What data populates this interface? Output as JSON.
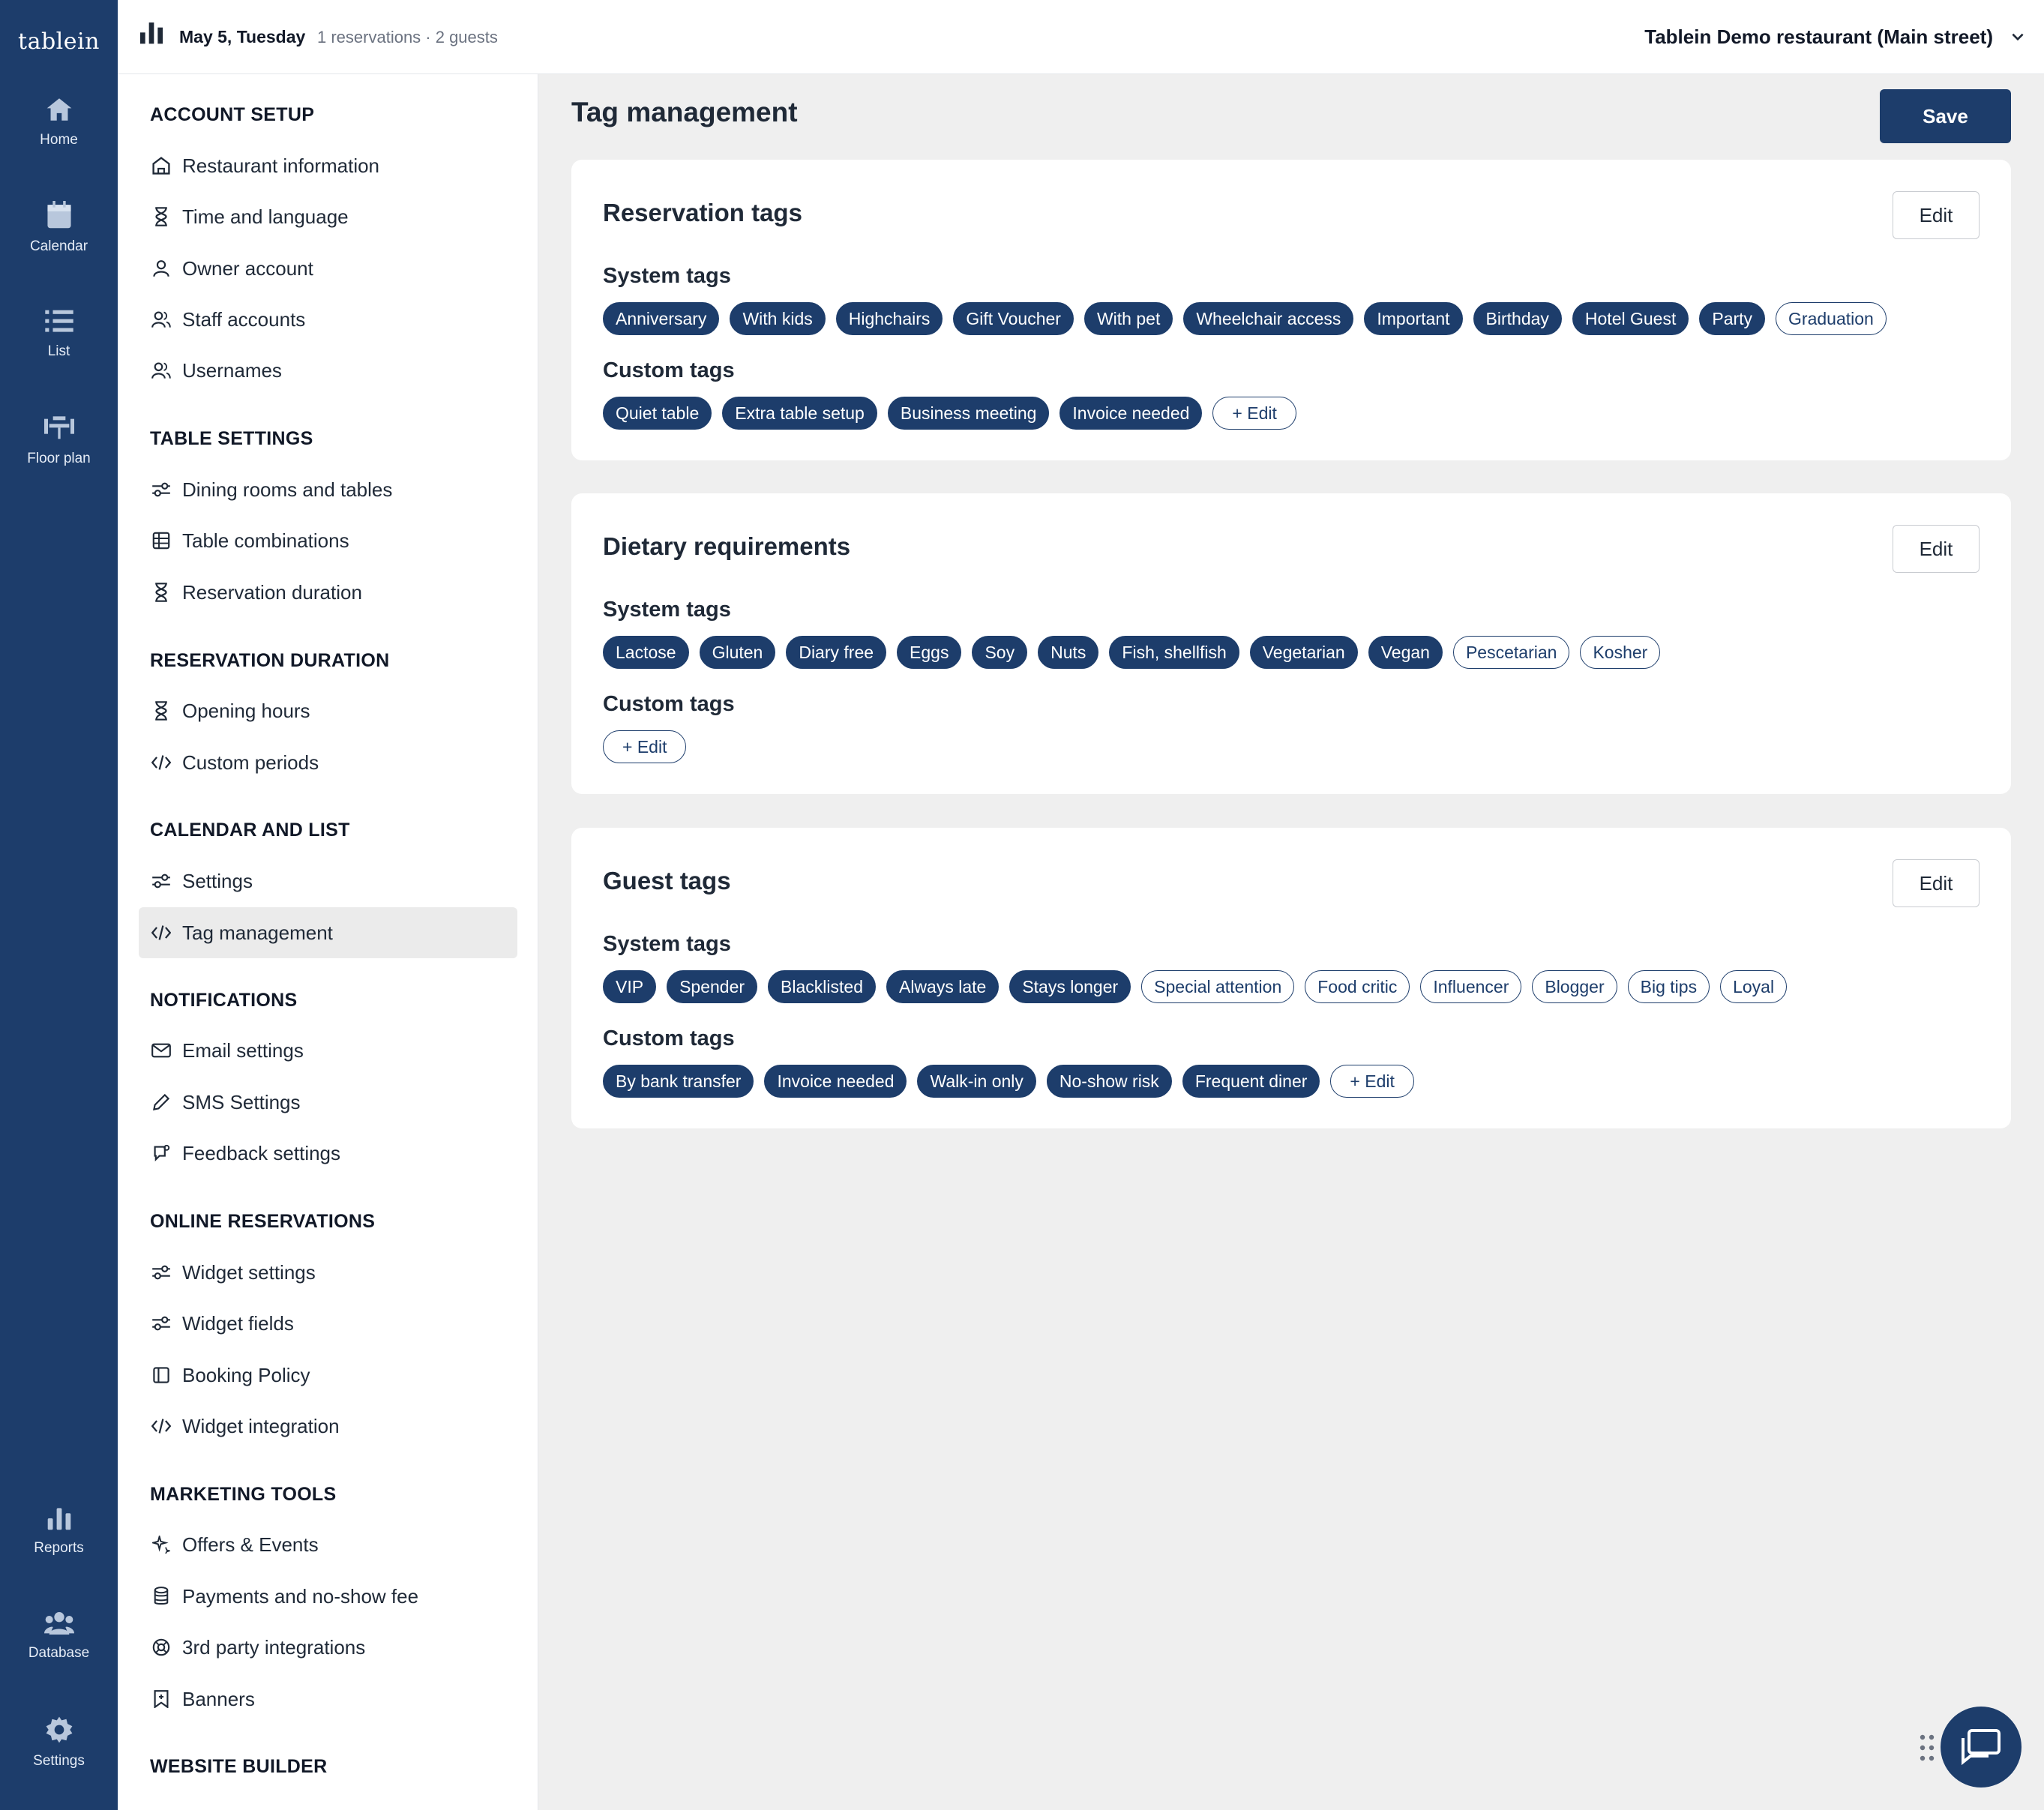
{
  "app": {
    "logo": "tablein"
  },
  "rail": {
    "items": [
      {
        "label": "Home",
        "icon": "home-icon"
      },
      {
        "label": "Calendar",
        "icon": "calendar-icon"
      },
      {
        "label": "List",
        "icon": "list-icon"
      },
      {
        "label": "Floor plan",
        "icon": "floor-plan-icon"
      },
      {
        "label": "Reports",
        "icon": "reports-icon"
      },
      {
        "label": "Database",
        "icon": "database-icon"
      },
      {
        "label": "Settings",
        "icon": "gear-icon"
      }
    ]
  },
  "topbar": {
    "date": "May 5, Tuesday",
    "meta": "1 reservations · 2 guests",
    "restaurant": "Tablein Demo restaurant (Main street)"
  },
  "nav": {
    "sections": [
      {
        "title": "ACCOUNT SETUP",
        "items": [
          {
            "label": "Restaurant information",
            "icon": "building-icon"
          },
          {
            "label": "Time and language",
            "icon": "hourglass-icon"
          },
          {
            "label": "Owner account",
            "icon": "user-icon"
          },
          {
            "label": "Staff accounts",
            "icon": "users-icon"
          },
          {
            "label": "Usernames",
            "icon": "users-icon"
          }
        ]
      },
      {
        "title": "TABLE SETTINGS",
        "items": [
          {
            "label": "Dining rooms and tables",
            "icon": "sliders-icon"
          },
          {
            "label": "Table combinations",
            "icon": "table-grid-icon"
          },
          {
            "label": "Reservation duration",
            "icon": "hourglass-icon"
          }
        ]
      },
      {
        "title": "RESERVATION DURATION",
        "items": [
          {
            "label": "Opening hours",
            "icon": "hourglass-icon"
          },
          {
            "label": "Custom periods",
            "icon": "code-icon"
          }
        ]
      },
      {
        "title": "CALENDAR AND LIST",
        "items": [
          {
            "label": "Settings",
            "icon": "sliders-icon"
          },
          {
            "label": "Tag management",
            "icon": "code-icon",
            "active": true
          }
        ]
      },
      {
        "title": "NOTIFICATIONS",
        "items": [
          {
            "label": "Email settings",
            "icon": "mail-icon"
          },
          {
            "label": "SMS Settings",
            "icon": "pencil-icon"
          },
          {
            "label": "Feedback settings",
            "icon": "feedback-icon"
          }
        ]
      },
      {
        "title": "ONLINE RESERVATIONS",
        "items": [
          {
            "label": "Widget settings",
            "icon": "sliders-icon"
          },
          {
            "label": "Widget fields",
            "icon": "sliders-icon"
          },
          {
            "label": "Booking Policy",
            "icon": "book-icon"
          },
          {
            "label": "Widget integration",
            "icon": "code-icon"
          }
        ]
      },
      {
        "title": "MARKETING TOOLS",
        "items": [
          {
            "label": "Offers & Events",
            "icon": "sparkle-icon"
          },
          {
            "label": "Payments and no-show fee",
            "icon": "coins-icon"
          },
          {
            "label": "3rd party integrations",
            "icon": "lifebuoy-icon"
          },
          {
            "label": "Banners",
            "icon": "bookmark-icon"
          }
        ]
      },
      {
        "title": "WEBSITE BUILDER",
        "items": []
      }
    ]
  },
  "main": {
    "title": "Tag management",
    "save_label": "Save",
    "edit_label": "Edit",
    "system_label": "System tags",
    "custom_label": "Custom tags",
    "add_label": "+ Edit",
    "cards": [
      {
        "title": "Reservation tags",
        "system": [
          {
            "label": "Anniversary",
            "on": true
          },
          {
            "label": "With kids",
            "on": true
          },
          {
            "label": "Highchairs",
            "on": true
          },
          {
            "label": "Gift Voucher",
            "on": true
          },
          {
            "label": "With pet",
            "on": true
          },
          {
            "label": "Wheelchair access",
            "on": true
          },
          {
            "label": "Important",
            "on": true
          },
          {
            "label": "Birthday",
            "on": true
          },
          {
            "label": "Hotel Guest",
            "on": true
          },
          {
            "label": "Party",
            "on": true
          },
          {
            "label": "Graduation",
            "on": false
          }
        ],
        "custom": [
          "Quiet table",
          "Extra table setup",
          "Business meeting",
          "Invoice needed"
        ]
      },
      {
        "title": "Dietary requirements",
        "system": [
          {
            "label": "Lactose",
            "on": true
          },
          {
            "label": "Gluten",
            "on": true
          },
          {
            "label": "Diary free",
            "on": true
          },
          {
            "label": "Eggs",
            "on": true
          },
          {
            "label": "Soy",
            "on": true
          },
          {
            "label": "Nuts",
            "on": true
          },
          {
            "label": "Fish, shellfish",
            "on": true
          },
          {
            "label": "Vegetarian",
            "on": true
          },
          {
            "label": "Vegan",
            "on": true
          },
          {
            "label": "Pescetarian",
            "on": false
          },
          {
            "label": "Kosher",
            "on": false
          }
        ],
        "custom": []
      },
      {
        "title": "Guest tags",
        "system": [
          {
            "label": "VIP",
            "on": true
          },
          {
            "label": "Spender",
            "on": true
          },
          {
            "label": "Blacklisted",
            "on": true
          },
          {
            "label": "Always late",
            "on": true
          },
          {
            "label": "Stays longer",
            "on": true
          },
          {
            "label": "Special attention",
            "on": false
          },
          {
            "label": "Food critic",
            "on": false
          },
          {
            "label": "Influencer",
            "on": false
          },
          {
            "label": "Blogger",
            "on": false
          },
          {
            "label": "Big tips",
            "on": false
          },
          {
            "label": "Loyal",
            "on": false
          }
        ],
        "custom": [
          "By bank transfer",
          "Invoice needed",
          "Walk-in only",
          "No-show risk",
          "Frequent diner"
        ]
      }
    ]
  },
  "colors": {
    "brand": "#1d3d6b",
    "background": "#efefef",
    "active_nav": "#ebebeb"
  }
}
